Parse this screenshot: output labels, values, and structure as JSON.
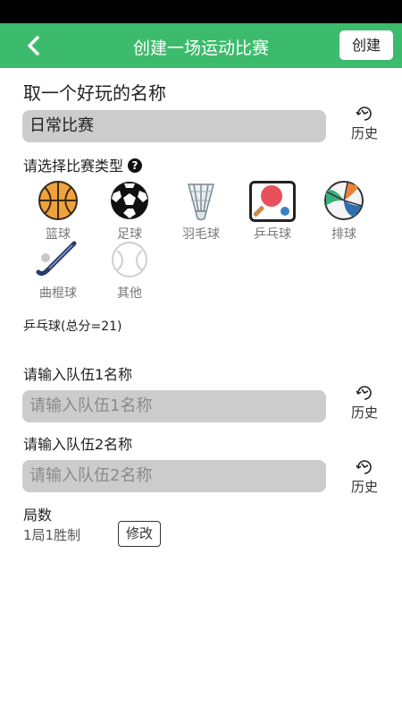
{
  "appbar": {
    "title": "创建一场运动比赛",
    "create_label": "创建"
  },
  "name_section": {
    "title": "取一个好玩的名称",
    "value": "日常比赛",
    "history_label": "历史"
  },
  "type_section": {
    "title": "请选择比赛类型",
    "help_icon": "question-mark-icon",
    "sports": [
      {
        "label": "篮球",
        "icon": "basketball-icon"
      },
      {
        "label": "足球",
        "icon": "soccer-ball-icon"
      },
      {
        "label": "羽毛球",
        "icon": "shuttlecock-icon"
      },
      {
        "label": "乒乓球",
        "icon": "ping-pong-icon",
        "selected": true
      },
      {
        "label": "排球",
        "icon": "volleyball-icon"
      },
      {
        "label": "曲棍球",
        "icon": "hockey-stick-icon"
      },
      {
        "label": "其他",
        "icon": "other-ball-icon"
      }
    ],
    "selected_rule": "乒乓球(总分=21)"
  },
  "team1": {
    "title": "请输入队伍1名称",
    "placeholder": "请输入队伍1名称",
    "history_label": "历史"
  },
  "team2": {
    "title": "请输入队伍2名称",
    "placeholder": "请输入队伍2名称",
    "history_label": "历史"
  },
  "rounds": {
    "title": "局数",
    "value": "1局1胜制",
    "modify_label": "修改"
  },
  "colors": {
    "appbar": "#3dbb6c",
    "input_bg": "#cccccc"
  }
}
